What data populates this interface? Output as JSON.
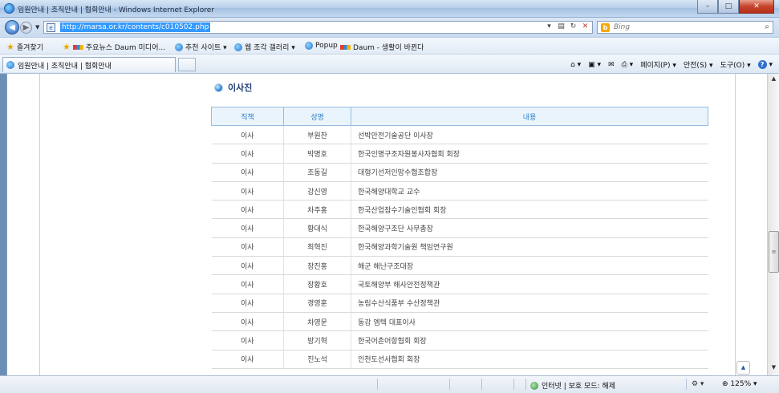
{
  "window": {
    "title": "임원안내 | 조직안내 | 협회안내 - Windows Internet Explorer",
    "minimize": "–",
    "maximize": "□",
    "close": "✕"
  },
  "address_bar": {
    "url": "http://marsa.or.kr/contents/c010502.php",
    "search_placeholder": "Bing"
  },
  "favorites": {
    "favorites_label": "즐겨찾기",
    "items": [
      "주요뉴스 Daum 미디어...",
      "추천 사이트 ▾",
      "웹 조각 갤러리 ▾",
      "Popup",
      "Daum - 생활이 바뀐다"
    ]
  },
  "tab": {
    "label": "임원안내 | 조직안내 | 협회안내"
  },
  "command_bar": {
    "page": "페이지(P) ▾",
    "safety": "안전(S) ▾",
    "tools": "도구(O) ▾"
  },
  "section": {
    "title": "이사진"
  },
  "table": {
    "headers": [
      "직책",
      "성명",
      "내용"
    ],
    "rows": [
      [
        "이사",
        "부원찬",
        "선박안전기술공단 이사장"
      ],
      [
        "이사",
        "박명호",
        "한국인명구조자원봉사자협회 회장"
      ],
      [
        "이사",
        "조동길",
        "대형기선저인망수협조합장"
      ],
      [
        "이사",
        "강신영",
        "한국해양대학교 교수"
      ],
      [
        "이사",
        "차주홍",
        "한국산업잠수기술인협회 회장"
      ],
      [
        "이사",
        "황대식",
        "한국해양구조단 사무총장"
      ],
      [
        "이사",
        "최혁진",
        "한국해양과학기술원 책임연구원"
      ],
      [
        "이사",
        "장진홍",
        "해군 해난구조대장"
      ],
      [
        "이사",
        "장황호",
        "국토해양부 해사안전정책관"
      ],
      [
        "이사",
        "경영훈",
        "농림수산식품부 수산정책관"
      ],
      [
        "이사",
        "차영문",
        "동강 엠텍 대표이사"
      ],
      [
        "이사",
        "방기혁",
        "한국어촌어항협회 회장"
      ],
      [
        "이사",
        "진노석",
        "인천도선사협회 회장"
      ]
    ]
  },
  "status_bar": {
    "zone": "인터넷 | 보호 모드: 해제",
    "zoom": "125%"
  }
}
